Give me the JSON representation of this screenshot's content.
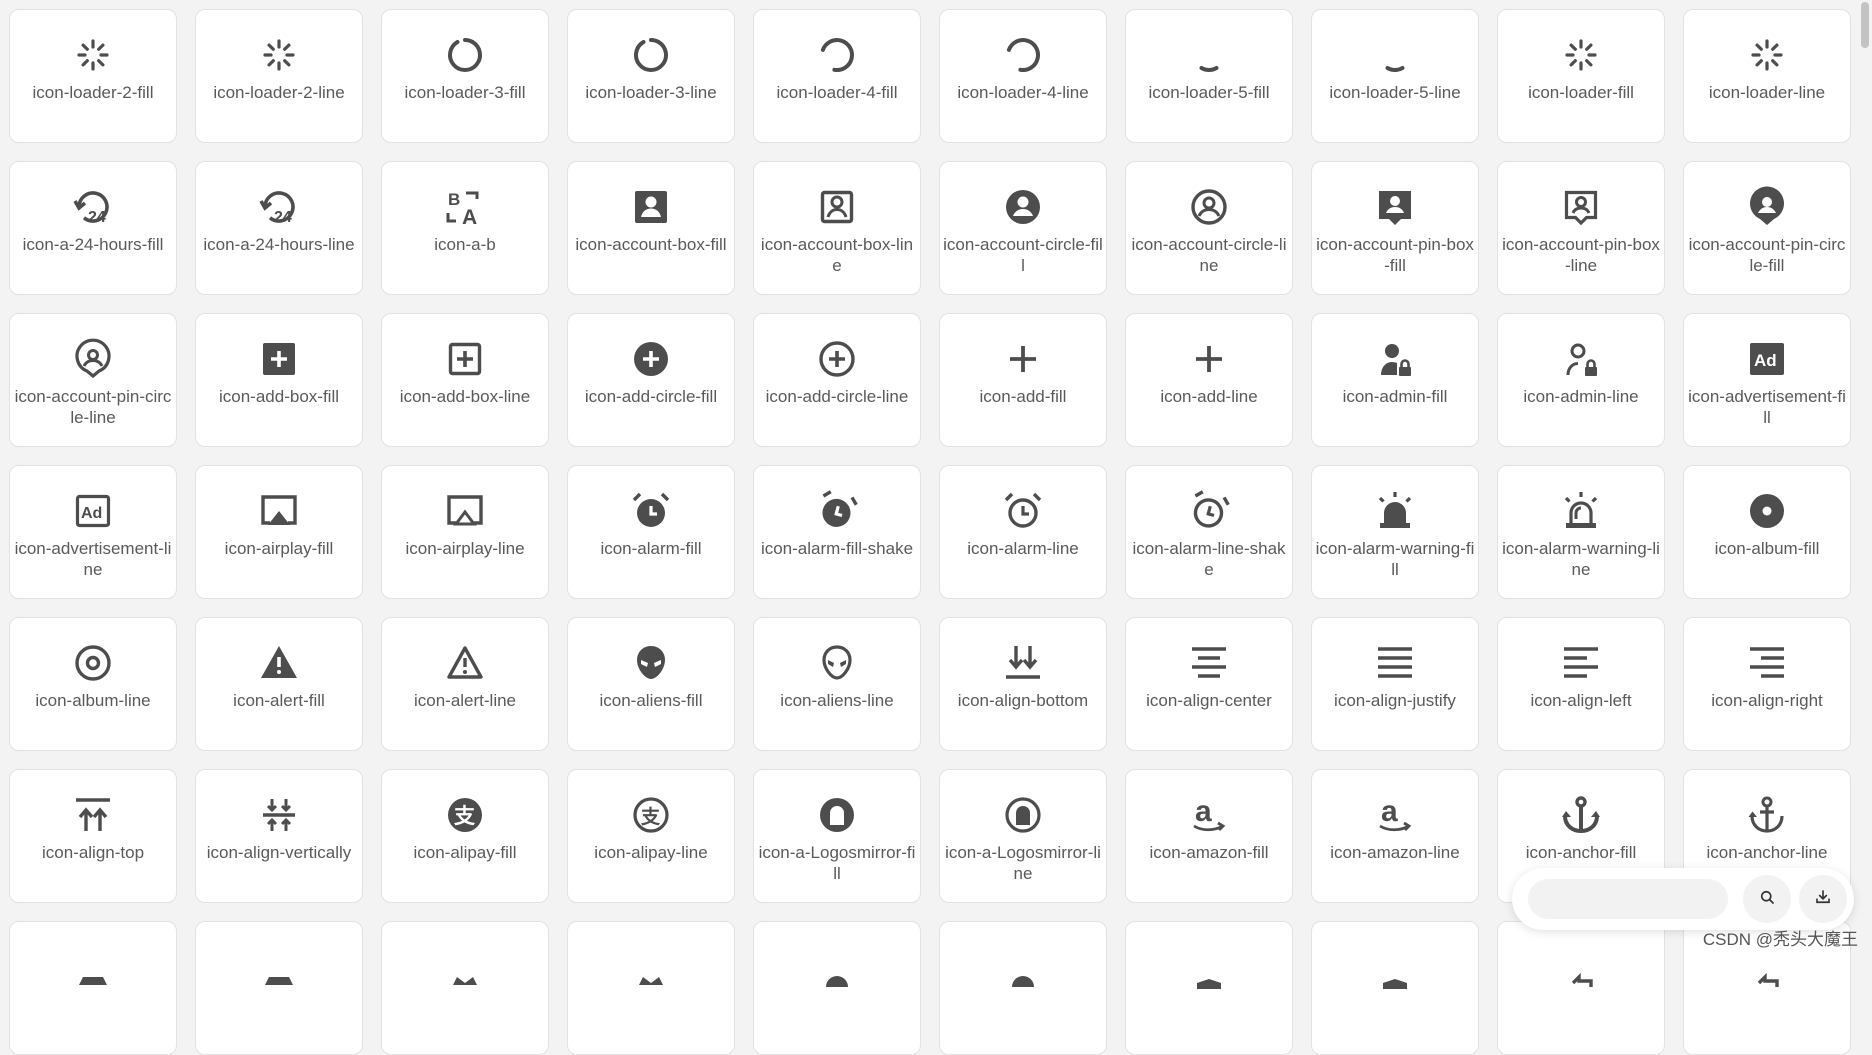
{
  "icon_color": "#4d4d4d",
  "cards": [
    {
      "icon": "loader-2",
      "label": "icon-loader-2-fill"
    },
    {
      "icon": "loader-2",
      "label": "icon-loader-2-line"
    },
    {
      "icon": "loader-3",
      "label": "icon-loader-3-fill"
    },
    {
      "icon": "loader-3",
      "label": "icon-loader-3-line"
    },
    {
      "icon": "loader-4",
      "label": "icon-loader-4-fill"
    },
    {
      "icon": "loader-4",
      "label": "icon-loader-4-line"
    },
    {
      "icon": "loader-5",
      "label": "icon-loader-5-fill"
    },
    {
      "icon": "loader-5",
      "label": "icon-loader-5-line"
    },
    {
      "icon": "loader",
      "label": "icon-loader-fill"
    },
    {
      "icon": "loader",
      "label": "icon-loader-line"
    },
    {
      "icon": "24-hours",
      "label": "icon-a-24-hours-fill"
    },
    {
      "icon": "24-hours",
      "label": "icon-a-24-hours-line"
    },
    {
      "icon": "a-b",
      "label": "icon-a-b"
    },
    {
      "icon": "account-box-fill",
      "label": "icon-account-box-fill"
    },
    {
      "icon": "account-box-line",
      "label": "icon-account-box-line"
    },
    {
      "icon": "account-circle-fill",
      "label": "icon-account-circle-fill"
    },
    {
      "icon": "account-circle-line",
      "label": "icon-account-circle-line"
    },
    {
      "icon": "account-pin-box-fill",
      "label": "icon-account-pin-box-fill"
    },
    {
      "icon": "account-pin-box-line",
      "label": "icon-account-pin-box-line"
    },
    {
      "icon": "account-pin-circle-fill",
      "label": "icon-account-pin-circle-fill"
    },
    {
      "icon": "account-pin-circle-line",
      "label": "icon-account-pin-circle-line"
    },
    {
      "icon": "add-box-fill",
      "label": "icon-add-box-fill"
    },
    {
      "icon": "add-box-line",
      "label": "icon-add-box-line"
    },
    {
      "icon": "add-circle-fill",
      "label": "icon-add-circle-fill"
    },
    {
      "icon": "add-circle-line",
      "label": "icon-add-circle-line"
    },
    {
      "icon": "add",
      "label": "icon-add-fill"
    },
    {
      "icon": "add",
      "label": "icon-add-line"
    },
    {
      "icon": "admin-fill",
      "label": "icon-admin-fill"
    },
    {
      "icon": "admin-line",
      "label": "icon-admin-line"
    },
    {
      "icon": "advertisement-fill",
      "label": "icon-advertisement-fill"
    },
    {
      "icon": "advertisement-line",
      "label": "icon-advertisement-line"
    },
    {
      "icon": "airplay-fill",
      "label": "icon-airplay-fill"
    },
    {
      "icon": "airplay-line",
      "label": "icon-airplay-line"
    },
    {
      "icon": "alarm-fill",
      "label": "icon-alarm-fill"
    },
    {
      "icon": "alarm-fill-shake",
      "label": "icon-alarm-fill-shake"
    },
    {
      "icon": "alarm-line",
      "label": "icon-alarm-line"
    },
    {
      "icon": "alarm-line-shake",
      "label": "icon-alarm-line-shake"
    },
    {
      "icon": "alarm-warning-fill",
      "label": "icon-alarm-warning-fill"
    },
    {
      "icon": "alarm-warning-line",
      "label": "icon-alarm-warning-line"
    },
    {
      "icon": "album-fill",
      "label": "icon-album-fill"
    },
    {
      "icon": "album-line",
      "label": "icon-album-line"
    },
    {
      "icon": "alert-fill",
      "label": "icon-alert-fill"
    },
    {
      "icon": "alert-line",
      "label": "icon-alert-line"
    },
    {
      "icon": "aliens-fill",
      "label": "icon-aliens-fill"
    },
    {
      "icon": "aliens-line",
      "label": "icon-aliens-line"
    },
    {
      "icon": "align-bottom",
      "label": "icon-align-bottom"
    },
    {
      "icon": "align-center",
      "label": "icon-align-center"
    },
    {
      "icon": "align-justify",
      "label": "icon-align-justify"
    },
    {
      "icon": "align-left",
      "label": "icon-align-left"
    },
    {
      "icon": "align-right",
      "label": "icon-align-right"
    },
    {
      "icon": "align-top",
      "label": "icon-align-top"
    },
    {
      "icon": "align-vertically",
      "label": "icon-align-vertically"
    },
    {
      "icon": "alipay-fill",
      "label": "icon-alipay-fill"
    },
    {
      "icon": "alipay-line",
      "label": "icon-alipay-line"
    },
    {
      "icon": "logosmirror-fill",
      "label": "icon-a-Logosmirror-fill"
    },
    {
      "icon": "logosmirror-line",
      "label": "icon-a-Logosmirror-line"
    },
    {
      "icon": "amazon",
      "label": "icon-amazon-fill"
    },
    {
      "icon": "amazon",
      "label": "icon-amazon-line"
    },
    {
      "icon": "anchor-fill",
      "label": "icon-anchor-fill"
    },
    {
      "icon": "anchor-line",
      "label": "icon-anchor-line"
    },
    {
      "icon": "partial-ship",
      "label": ""
    },
    {
      "icon": "partial-ship",
      "label": ""
    },
    {
      "icon": "partial-crown",
      "label": ""
    },
    {
      "icon": "partial-crown",
      "label": ""
    },
    {
      "icon": "partial-android",
      "label": ""
    },
    {
      "icon": "partial-android",
      "label": ""
    },
    {
      "icon": "partial-angularjs",
      "label": ""
    },
    {
      "icon": "partial-angularjs",
      "label": ""
    },
    {
      "icon": "partial-arrow",
      "label": ""
    },
    {
      "icon": "partial-arrow",
      "label": ""
    }
  ],
  "search": {
    "placeholder": "",
    "search_icon": "search-icon",
    "download_icon": "download-icon"
  },
  "watermark": "CSDN @秃头大魔王"
}
